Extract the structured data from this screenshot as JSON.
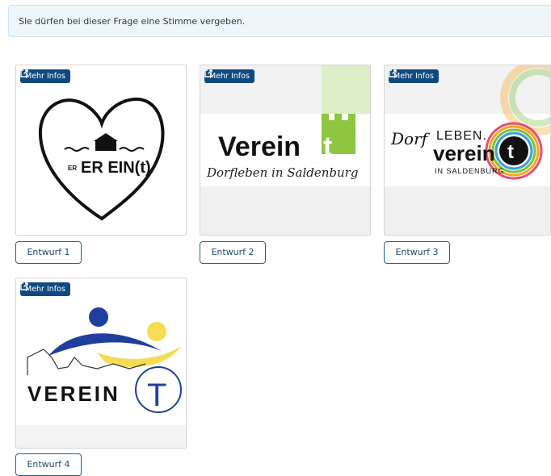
{
  "notice": {
    "text": "Sie dürfen bei dieser Frage eine Stimme vergeben."
  },
  "options": [
    {
      "badge": "Mehr Infos",
      "button": "Entwurf 1",
      "logo_text": "ER EIN(t)"
    },
    {
      "badge": "Mehr Infos",
      "button": "Entwurf 2",
      "logo_text": "Verein",
      "logo_accent": "t",
      "logo_sub": "Dorfleben in Saldenburg"
    },
    {
      "badge": "Mehr Infos",
      "button": "Entwurf 3",
      "logo_dorf": "Dorf",
      "logo_leben": "LEBEN.",
      "logo_text": "verein",
      "logo_accent": "t",
      "logo_sub": "IN SALDENBURG"
    },
    {
      "badge": "Mehr Infos",
      "button": "Entwurf 4",
      "logo_text": "VEREIN",
      "logo_accent": "T"
    }
  ],
  "colors": {
    "badge_bg": "#0e4a80",
    "button_border": "#2d5f8c",
    "green": "#8dc63f",
    "blue": "#1f3f9e",
    "yellow": "#f5dc55"
  },
  "icons": {
    "badge": "external-link-icon"
  }
}
